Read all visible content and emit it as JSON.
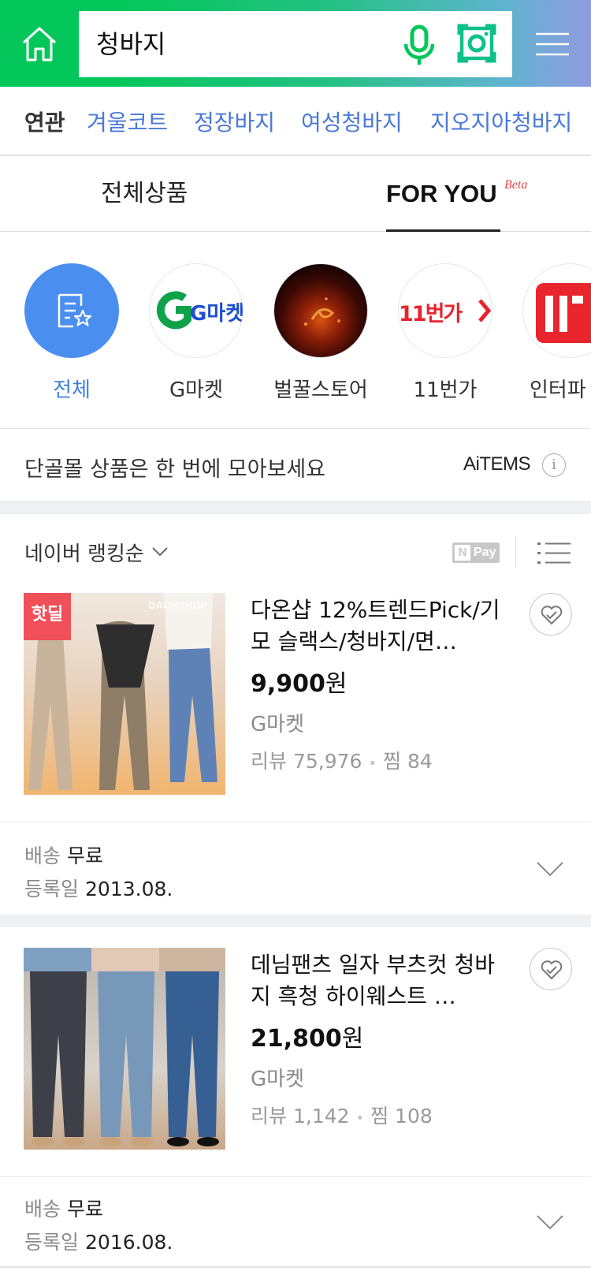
{
  "search": {
    "query": "청바지"
  },
  "related": {
    "label": "연관",
    "keywords": [
      "겨울코트",
      "정장바지",
      "여성청바지",
      "지오지아청바지"
    ]
  },
  "tabs": {
    "all": "전체상품",
    "foryou": "FOR YOU",
    "beta": "Beta",
    "active": "FOR YOU"
  },
  "malls": [
    {
      "label": "전체",
      "selected": true
    },
    {
      "label": "G마켓",
      "selected": false
    },
    {
      "label": "벌꿀스토어",
      "selected": false
    },
    {
      "label": "11번가",
      "selected": false
    },
    {
      "label": "인터파",
      "selected": false
    }
  ],
  "mall_logos": {
    "gmarket": "G마켓",
    "st11": "11번가"
  },
  "notice": {
    "text": "단골몰 상품은 한 번에 모아보세요",
    "brand": "AiTEMS",
    "info": "i"
  },
  "sort": {
    "label": "네이버 랭킹순",
    "npay": "Pay",
    "npay_n": "N"
  },
  "products": [
    {
      "title": "다온샵 12%트렌드Pick/기모 슬랙스/청바지/면…",
      "price": "9,900",
      "currency": "원",
      "mall": "G마켓",
      "review_label": "리뷰",
      "reviews": "75,976",
      "zzim_label": "찜",
      "zzim": "84",
      "badge": "핫딜",
      "watermark": "DAONSHOP",
      "ship_label": "배송",
      "ship_value": "무료",
      "reg_label": "등록일",
      "reg_value": "2013.08."
    },
    {
      "title": "데님팬츠 일자 부츠컷 청바지 흑청 하이웨스트 …",
      "price": "21,800",
      "currency": "원",
      "mall": "G마켓",
      "review_label": "리뷰",
      "reviews": "1,142",
      "zzim_label": "찜",
      "zzim": "108",
      "ship_label": "배송",
      "ship_value": "무료",
      "reg_label": "등록일",
      "reg_value": "2016.08."
    }
  ],
  "colors": {
    "naver_green": "#03c75a",
    "link_blue": "#4a78d9",
    "mall_all_blue": "#4a8ff0",
    "hot_red": "#f0505a",
    "beta_red": "#e2454b"
  },
  "icons": [
    "home-icon",
    "mic-icon",
    "lens-icon",
    "menu-icon",
    "chevron-down-icon",
    "list-view-icon",
    "heart-check-icon",
    "info-icon",
    "star-list-icon"
  ]
}
